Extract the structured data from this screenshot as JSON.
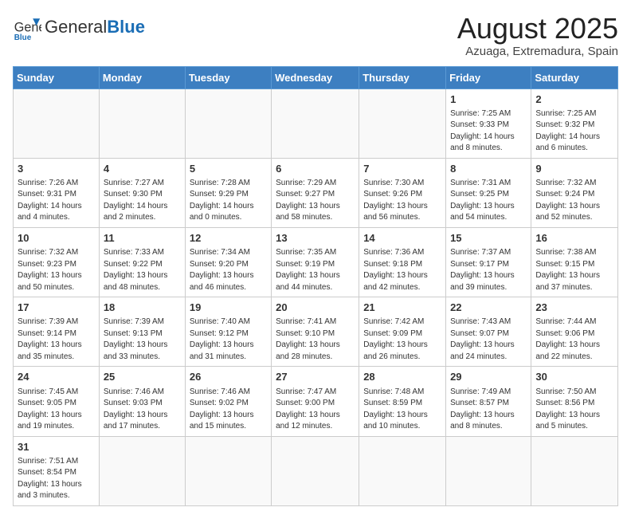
{
  "header": {
    "logo_general": "General",
    "logo_blue": "Blue",
    "month_title": "August 2025",
    "location": "Azuaga, Extremadura, Spain"
  },
  "weekdays": [
    "Sunday",
    "Monday",
    "Tuesday",
    "Wednesday",
    "Thursday",
    "Friday",
    "Saturday"
  ],
  "weeks": [
    [
      {
        "day": "",
        "info": ""
      },
      {
        "day": "",
        "info": ""
      },
      {
        "day": "",
        "info": ""
      },
      {
        "day": "",
        "info": ""
      },
      {
        "day": "",
        "info": ""
      },
      {
        "day": "1",
        "info": "Sunrise: 7:25 AM\nSunset: 9:33 PM\nDaylight: 14 hours and 8 minutes."
      },
      {
        "day": "2",
        "info": "Sunrise: 7:25 AM\nSunset: 9:32 PM\nDaylight: 14 hours and 6 minutes."
      }
    ],
    [
      {
        "day": "3",
        "info": "Sunrise: 7:26 AM\nSunset: 9:31 PM\nDaylight: 14 hours and 4 minutes."
      },
      {
        "day": "4",
        "info": "Sunrise: 7:27 AM\nSunset: 9:30 PM\nDaylight: 14 hours and 2 minutes."
      },
      {
        "day": "5",
        "info": "Sunrise: 7:28 AM\nSunset: 9:29 PM\nDaylight: 14 hours and 0 minutes."
      },
      {
        "day": "6",
        "info": "Sunrise: 7:29 AM\nSunset: 9:27 PM\nDaylight: 13 hours and 58 minutes."
      },
      {
        "day": "7",
        "info": "Sunrise: 7:30 AM\nSunset: 9:26 PM\nDaylight: 13 hours and 56 minutes."
      },
      {
        "day": "8",
        "info": "Sunrise: 7:31 AM\nSunset: 9:25 PM\nDaylight: 13 hours and 54 minutes."
      },
      {
        "day": "9",
        "info": "Sunrise: 7:32 AM\nSunset: 9:24 PM\nDaylight: 13 hours and 52 minutes."
      }
    ],
    [
      {
        "day": "10",
        "info": "Sunrise: 7:32 AM\nSunset: 9:23 PM\nDaylight: 13 hours and 50 minutes."
      },
      {
        "day": "11",
        "info": "Sunrise: 7:33 AM\nSunset: 9:22 PM\nDaylight: 13 hours and 48 minutes."
      },
      {
        "day": "12",
        "info": "Sunrise: 7:34 AM\nSunset: 9:20 PM\nDaylight: 13 hours and 46 minutes."
      },
      {
        "day": "13",
        "info": "Sunrise: 7:35 AM\nSunset: 9:19 PM\nDaylight: 13 hours and 44 minutes."
      },
      {
        "day": "14",
        "info": "Sunrise: 7:36 AM\nSunset: 9:18 PM\nDaylight: 13 hours and 42 minutes."
      },
      {
        "day": "15",
        "info": "Sunrise: 7:37 AM\nSunset: 9:17 PM\nDaylight: 13 hours and 39 minutes."
      },
      {
        "day": "16",
        "info": "Sunrise: 7:38 AM\nSunset: 9:15 PM\nDaylight: 13 hours and 37 minutes."
      }
    ],
    [
      {
        "day": "17",
        "info": "Sunrise: 7:39 AM\nSunset: 9:14 PM\nDaylight: 13 hours and 35 minutes."
      },
      {
        "day": "18",
        "info": "Sunrise: 7:39 AM\nSunset: 9:13 PM\nDaylight: 13 hours and 33 minutes."
      },
      {
        "day": "19",
        "info": "Sunrise: 7:40 AM\nSunset: 9:12 PM\nDaylight: 13 hours and 31 minutes."
      },
      {
        "day": "20",
        "info": "Sunrise: 7:41 AM\nSunset: 9:10 PM\nDaylight: 13 hours and 28 minutes."
      },
      {
        "day": "21",
        "info": "Sunrise: 7:42 AM\nSunset: 9:09 PM\nDaylight: 13 hours and 26 minutes."
      },
      {
        "day": "22",
        "info": "Sunrise: 7:43 AM\nSunset: 9:07 PM\nDaylight: 13 hours and 24 minutes."
      },
      {
        "day": "23",
        "info": "Sunrise: 7:44 AM\nSunset: 9:06 PM\nDaylight: 13 hours and 22 minutes."
      }
    ],
    [
      {
        "day": "24",
        "info": "Sunrise: 7:45 AM\nSunset: 9:05 PM\nDaylight: 13 hours and 19 minutes."
      },
      {
        "day": "25",
        "info": "Sunrise: 7:46 AM\nSunset: 9:03 PM\nDaylight: 13 hours and 17 minutes."
      },
      {
        "day": "26",
        "info": "Sunrise: 7:46 AM\nSunset: 9:02 PM\nDaylight: 13 hours and 15 minutes."
      },
      {
        "day": "27",
        "info": "Sunrise: 7:47 AM\nSunset: 9:00 PM\nDaylight: 13 hours and 12 minutes."
      },
      {
        "day": "28",
        "info": "Sunrise: 7:48 AM\nSunset: 8:59 PM\nDaylight: 13 hours and 10 minutes."
      },
      {
        "day": "29",
        "info": "Sunrise: 7:49 AM\nSunset: 8:57 PM\nDaylight: 13 hours and 8 minutes."
      },
      {
        "day": "30",
        "info": "Sunrise: 7:50 AM\nSunset: 8:56 PM\nDaylight: 13 hours and 5 minutes."
      }
    ],
    [
      {
        "day": "31",
        "info": "Sunrise: 7:51 AM\nSunset: 8:54 PM\nDaylight: 13 hours and 3 minutes."
      },
      {
        "day": "",
        "info": ""
      },
      {
        "day": "",
        "info": ""
      },
      {
        "day": "",
        "info": ""
      },
      {
        "day": "",
        "info": ""
      },
      {
        "day": "",
        "info": ""
      },
      {
        "day": "",
        "info": ""
      }
    ]
  ]
}
